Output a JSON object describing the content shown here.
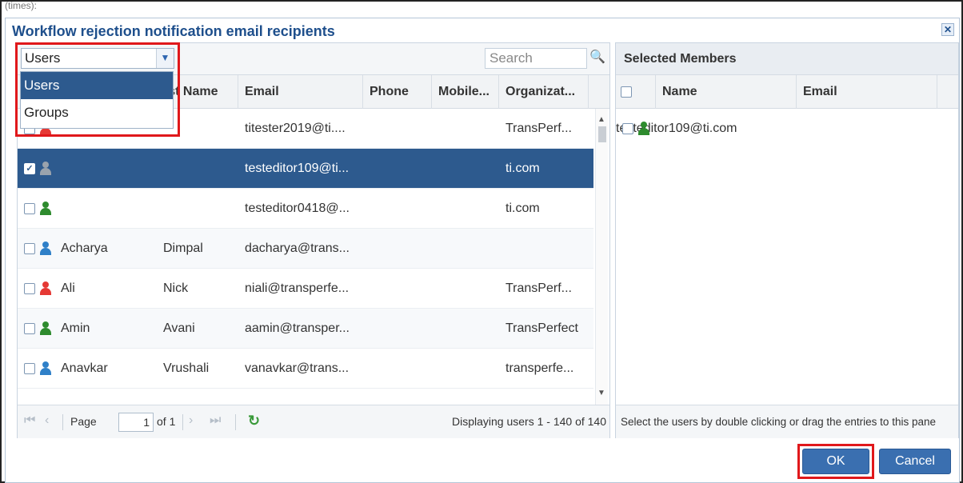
{
  "background_label": "(times):",
  "dialog": {
    "title": "Workflow rejection notification email recipients",
    "close_icon": "close-icon"
  },
  "left": {
    "type_select_value": "Users",
    "search_placeholder": "Search",
    "dropdown_options": [
      "Users",
      "Groups"
    ],
    "columns": [
      "rst Name",
      "Email",
      "Phone",
      "Mobile...",
      "Organizat..."
    ],
    "rows": [
      {
        "last": "",
        "first": "",
        "email": "titester2019@ti....",
        "phone": "",
        "mobile": "",
        "org": "TransPerf...",
        "icon_color": "#e53935",
        "checked": false,
        "selected": false
      },
      {
        "last": "",
        "first": "",
        "email": "testeditor109@ti...",
        "phone": "",
        "mobile": "",
        "org": "ti.com",
        "icon_color": "#9aa3ad",
        "checked": true,
        "selected": true
      },
      {
        "last": "",
        "first": "",
        "email": "testeditor0418@...",
        "phone": "",
        "mobile": "",
        "org": "ti.com",
        "icon_color": "#2e8b2e",
        "checked": false,
        "selected": false
      },
      {
        "last": "Acharya",
        "first": "Dimpal",
        "email": "dacharya@trans...",
        "phone": "",
        "mobile": "",
        "org": "",
        "icon_color": "#2f80c8",
        "checked": false,
        "selected": false
      },
      {
        "last": "Ali",
        "first": "Nick",
        "email": "niali@transperfe...",
        "phone": "",
        "mobile": "",
        "org": "TransPerf...",
        "icon_color": "#e53935",
        "checked": false,
        "selected": false
      },
      {
        "last": "Amin",
        "first": "Avani",
        "email": "aamin@transper...",
        "phone": "",
        "mobile": "",
        "org": "TransPerfect",
        "icon_color": "#2e8b2e",
        "checked": false,
        "selected": false
      },
      {
        "last": "Anavkar",
        "first": "Vrushali",
        "email": "vanavkar@trans...",
        "phone": "",
        "mobile": "",
        "org": "transperfe...",
        "icon_color": "#2f80c8",
        "checked": false,
        "selected": false
      }
    ],
    "pager": {
      "page_label": "Page",
      "page_value": "1",
      "of_label": "of 1",
      "display_text": "Displaying users 1 - 140 of 140"
    }
  },
  "right": {
    "title": "Selected Members",
    "columns": [
      "Name",
      "Email"
    ],
    "rows": [
      {
        "name": "",
        "email": "testeditor109@ti.com",
        "icon_color": "#2e8b2e"
      }
    ],
    "hint": "Select the users by double clicking or drag the entries to this pane"
  },
  "buttons": {
    "ok": "OK",
    "cancel": "Cancel"
  }
}
